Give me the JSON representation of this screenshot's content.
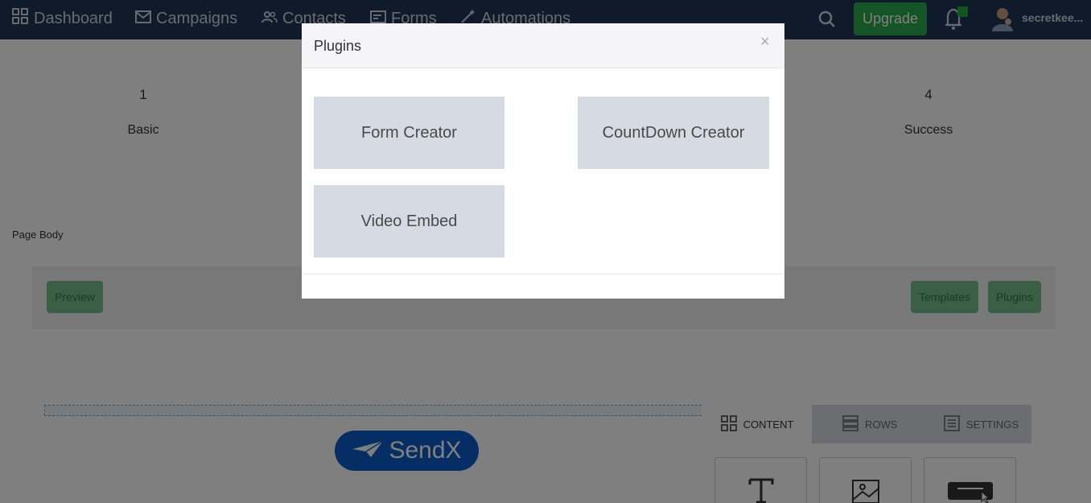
{
  "nav": {
    "dashboard": "Dashboard",
    "campaigns": "Campaigns",
    "contacts": "Contacts",
    "forms": "Forms",
    "automations": "Automations",
    "upgrade": "Upgrade",
    "username": "secretkee...",
    "icons": [
      "dashboard-icon",
      "mail-icon",
      "contacts-icon",
      "forms-icon",
      "magic-wand-icon",
      "search-icon",
      "bell-icon",
      "avatar-icon"
    ]
  },
  "steps": [
    {
      "number": "1",
      "label": "Basic"
    },
    {
      "number": "4",
      "label": "Success"
    }
  ],
  "page": {
    "body_label": "Page Body"
  },
  "toolbar": {
    "preview": "Preview",
    "templates": "Templates",
    "plugins": "Plugins"
  },
  "editor": {
    "logo_text": "SendX"
  },
  "side_panel": {
    "tabs": [
      "CONTENT",
      "ROWS",
      "SETTINGS"
    ]
  },
  "modal": {
    "title": "Plugins",
    "close": "×",
    "plugins": [
      "Form Creator",
      "CountDown Creator",
      "Video Embed"
    ]
  },
  "colors": {
    "nav_bg": "#1f3455",
    "upgrade": "#2aa84a",
    "card_bg": "#d5dae3",
    "brand_blue": "#0b5fc8"
  }
}
